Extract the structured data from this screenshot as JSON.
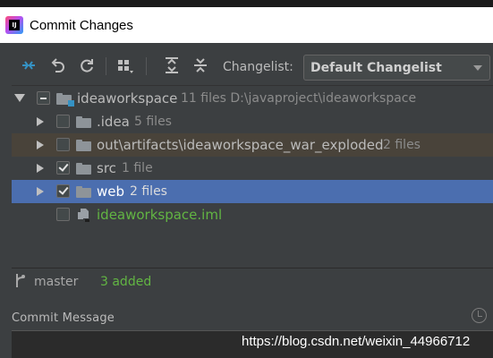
{
  "window": {
    "title": "Commit Changes",
    "logo_text": "IJ"
  },
  "toolbar": {
    "icons": [
      "show-diff-icon",
      "rollback-icon",
      "refresh-icon",
      "group-by-icon",
      "expand-all-icon",
      "collapse-all-icon"
    ],
    "changelist_label": "Changelist:",
    "changelist_value": "Default Changelist"
  },
  "tree": {
    "root": {
      "name": "ideaworkspace",
      "meta": "11 files  D:\\javaproject\\ideaworkspace"
    },
    "items": [
      {
        "name": ".idea",
        "meta": "5 files",
        "checked": false
      },
      {
        "name": "out\\artifacts\\ideaworkspace_war_exploded",
        "meta": "2 files",
        "checked": false
      },
      {
        "name": "src",
        "meta": "1 file",
        "checked": true
      },
      {
        "name": "web",
        "meta": "2 files",
        "checked": true
      },
      {
        "name": "ideaworkspace.iml",
        "meta": "",
        "checked": false
      }
    ]
  },
  "status": {
    "branch": "master",
    "added": "3 added"
  },
  "commit": {
    "label": "Commit Message"
  },
  "watermark": "https://blog.csdn.net/weixin_44966712",
  "colors": {
    "selection": "#4b6eaf",
    "added_green": "#62b543",
    "background": "#3c3f41"
  }
}
